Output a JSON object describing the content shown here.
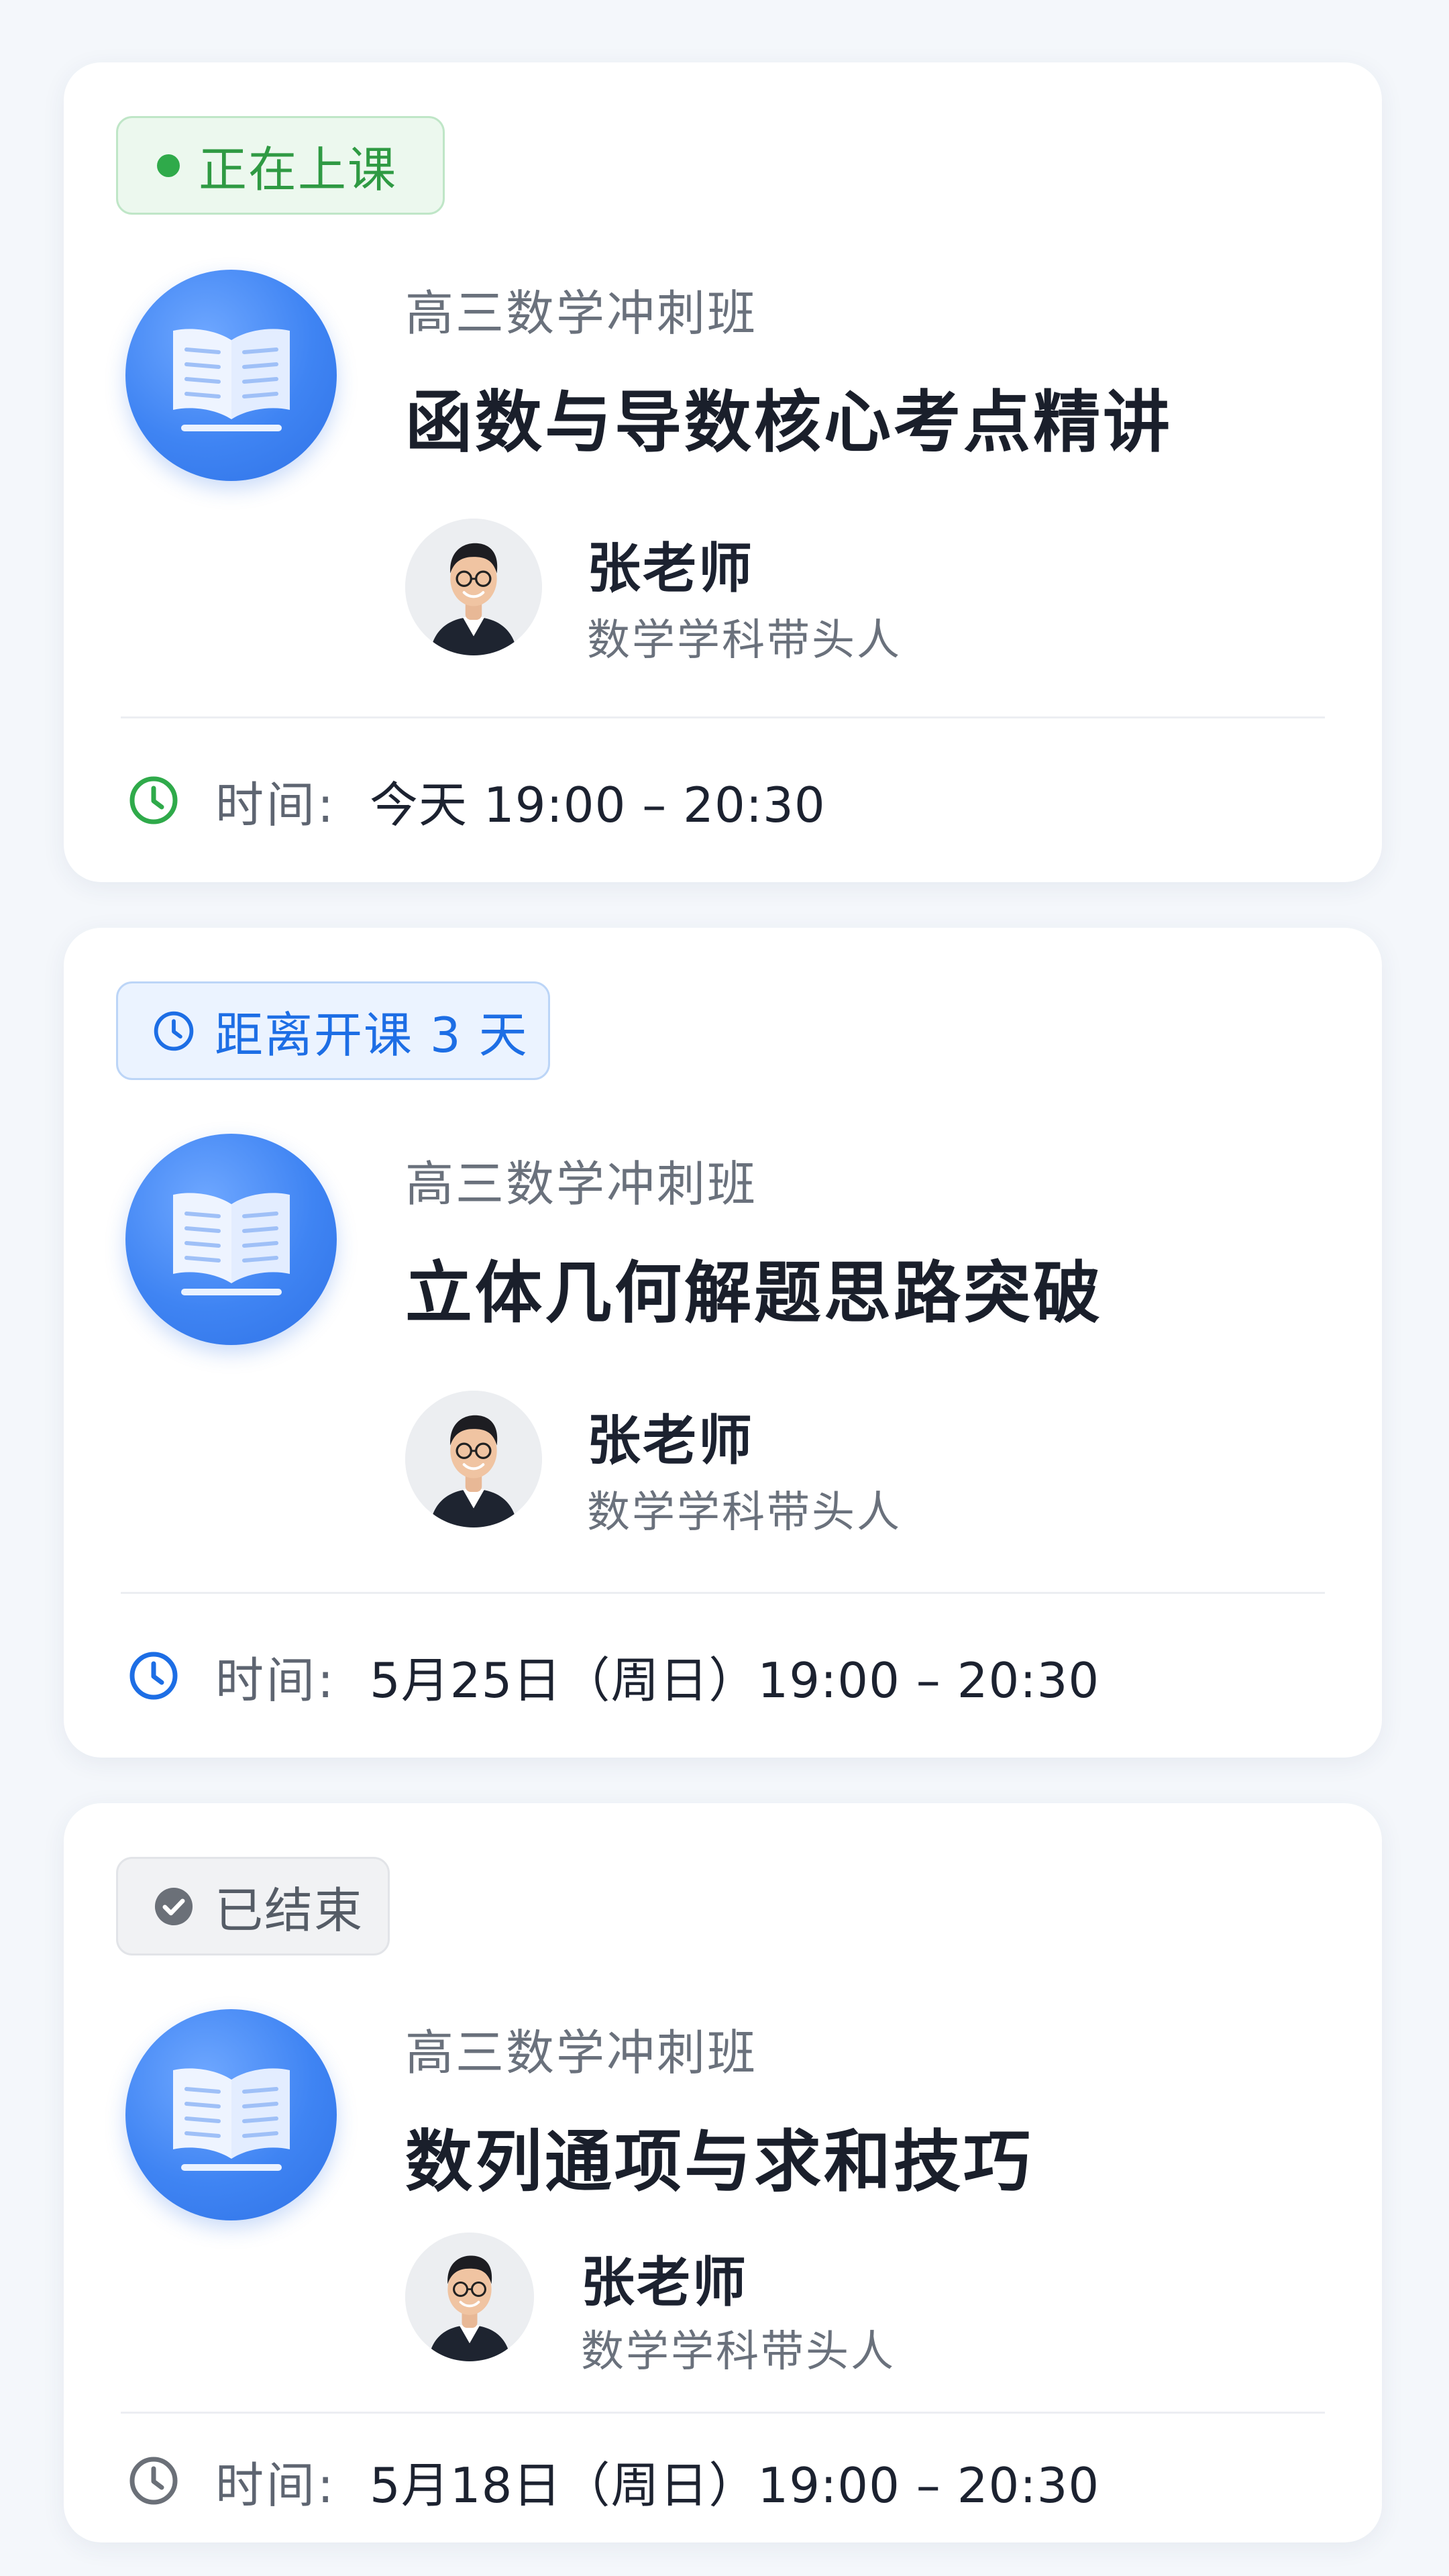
{
  "courses": [
    {
      "status": {
        "label": "正在上课",
        "color": "#2f9a43"
      },
      "class_name": "高三数学冲刺班",
      "title": "函数与导数核心考点精讲",
      "teacher": {
        "name": "张老师",
        "role": "数学学科带头人"
      },
      "time": {
        "label": "时间:",
        "value": "今天 19:00 – 20:30",
        "icon": "clock-icon"
      }
    },
    {
      "status": {
        "label": "距离开课 3 天",
        "color": "#1d6ee5"
      },
      "class_name": "高三数学冲刺班",
      "title": "立体几何解题思路突破",
      "teacher": {
        "name": "张老师",
        "role": "数学学科带头人"
      },
      "time": {
        "label": "时间:",
        "value": "5月25日（周日）19:00 – 20:30",
        "icon": "clock-icon"
      }
    },
    {
      "status": {
        "label": "已结束",
        "color": "#555c66"
      },
      "class_name": "高三数学冲刺班",
      "title": "数列通项与求和技巧",
      "teacher": {
        "name": "张老师",
        "role": "数学学科带头人"
      },
      "time": {
        "label": "时间:",
        "value": "5月18日（周日）19:00 – 20:30",
        "icon": "clock-icon"
      }
    }
  ],
  "colors": {
    "live_green": "#2faa4a",
    "accent_blue": "#2f72e6",
    "ended_gray": "#6b7078"
  }
}
